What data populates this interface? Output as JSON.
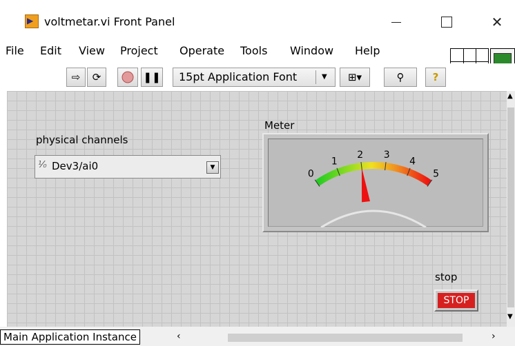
{
  "window": {
    "title": "voltmetar.vi Front Panel",
    "minimize": "—",
    "close": "✕"
  },
  "menu": {
    "items": [
      "File",
      "Edit",
      "View",
      "Project",
      "Operate",
      "Tools",
      "Window",
      "Help"
    ]
  },
  "toolbar": {
    "font": "15pt Application Font",
    "icons": [
      "run-arrow",
      "run-continuous",
      "abort-execution",
      "pause",
      "alignment",
      "search",
      "context-help"
    ]
  },
  "panel": {
    "channels_label": "physical channels",
    "channel_value": "Dev3/ai0",
    "channel_io_icon": "I/O",
    "meter_label": "Meter",
    "meter": {
      "scale_min": 0,
      "scale_max": 5,
      "ticks": [
        "0",
        "1",
        "2",
        "3",
        "4",
        "5"
      ],
      "value": 2
    },
    "stop_label": "stop",
    "stop_button": "STOP"
  },
  "status": {
    "context": "Main Application Instance"
  },
  "colors": {
    "panel_bg": "#d6d6d6",
    "stop_red": "#d62020",
    "needle_red": "#ee1111"
  }
}
